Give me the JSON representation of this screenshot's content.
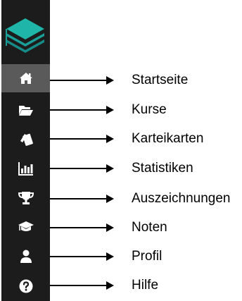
{
  "sidebar": {
    "logo_icon": "stacked-layers-logo",
    "colors": {
      "background": "#1c1c1c",
      "active_background": "#5a5a5a",
      "icon": "#ffffff",
      "logo": "#1aa8a0"
    },
    "active_item": "Startseite",
    "items": [
      {
        "icon": "home-icon",
        "label": "Startseite"
      },
      {
        "icon": "folder-open-icon",
        "label": "Kurse"
      },
      {
        "icon": "flashcards-icon",
        "label": "Karteikarten"
      },
      {
        "icon": "bar-chart-icon",
        "label": "Statistiken"
      },
      {
        "icon": "trophy-icon",
        "label": "Auszeichnungen"
      },
      {
        "icon": "graduation-cap-icon",
        "label": "Noten"
      },
      {
        "icon": "user-icon",
        "label": "Profil"
      },
      {
        "icon": "question-circle-icon",
        "label": "Hilfe"
      }
    ]
  }
}
